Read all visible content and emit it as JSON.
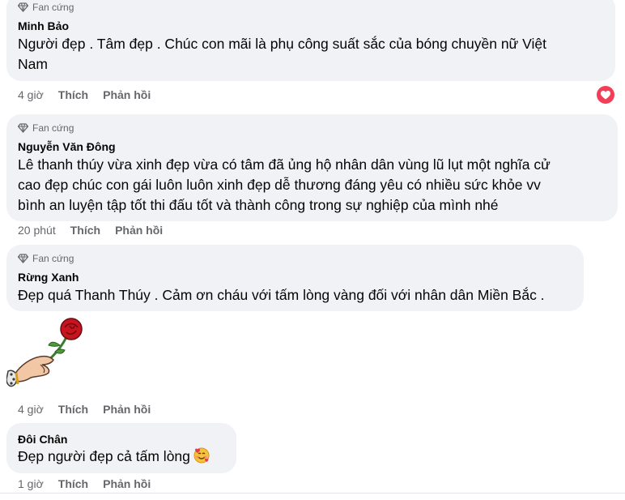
{
  "comments": [
    {
      "badge": "Fan cứng",
      "author": "Minh Bảo",
      "lines": [
        "Người đẹp . Tâm đẹp . Chúc con mãi là phụ công suất sắc của bóng chuyền nữ Việt",
        "Nam"
      ],
      "time": "4 giờ",
      "like": "Thích",
      "reply": "Phản hồi",
      "reaction": "heart-love"
    },
    {
      "badge": "Fan cứng",
      "author": "Nguyễn Văn Đông",
      "lines": [
        "Lê thanh thúy vừa xinh đẹp vừa có tâm đã ủng hộ nhân dân vùng lũ lụt một nghĩa cử",
        "cao đẹp chúc con gái luôn luôn xinh đẹp dễ thương đáng yêu có nhiều sức khỏe vv",
        "bình an luyện tập tốt thi đấu tốt và thành công trong sự nghiệp của mình nhé"
      ],
      "time": "20 phút",
      "like": "Thích",
      "reply": "Phản hồi"
    },
    {
      "badge": "Fan cứng",
      "author": "Rừng Xanh",
      "lines": [
        "Đẹp quá Thanh Thúy . Cảm ơn cháu với tấm lòng vàng đối với nhân dân Miền Bắc ."
      ],
      "sticker": "rose-in-hand-sticker",
      "time": "4 giờ",
      "like": "Thích",
      "reply": "Phản hồi"
    },
    {
      "author": "Đôi Chân",
      "lines": [
        "Đẹp người đẹp cả tấm lòng"
      ],
      "emoji": "smiling-face-with-hearts",
      "time": "1 giờ",
      "like": "Thích",
      "reply": "Phản hồi"
    }
  ],
  "colors": {
    "bubble": "#f0f2f5",
    "text": "#050505",
    "secondary": "#65676b",
    "love_reaction": "#f33e58"
  }
}
